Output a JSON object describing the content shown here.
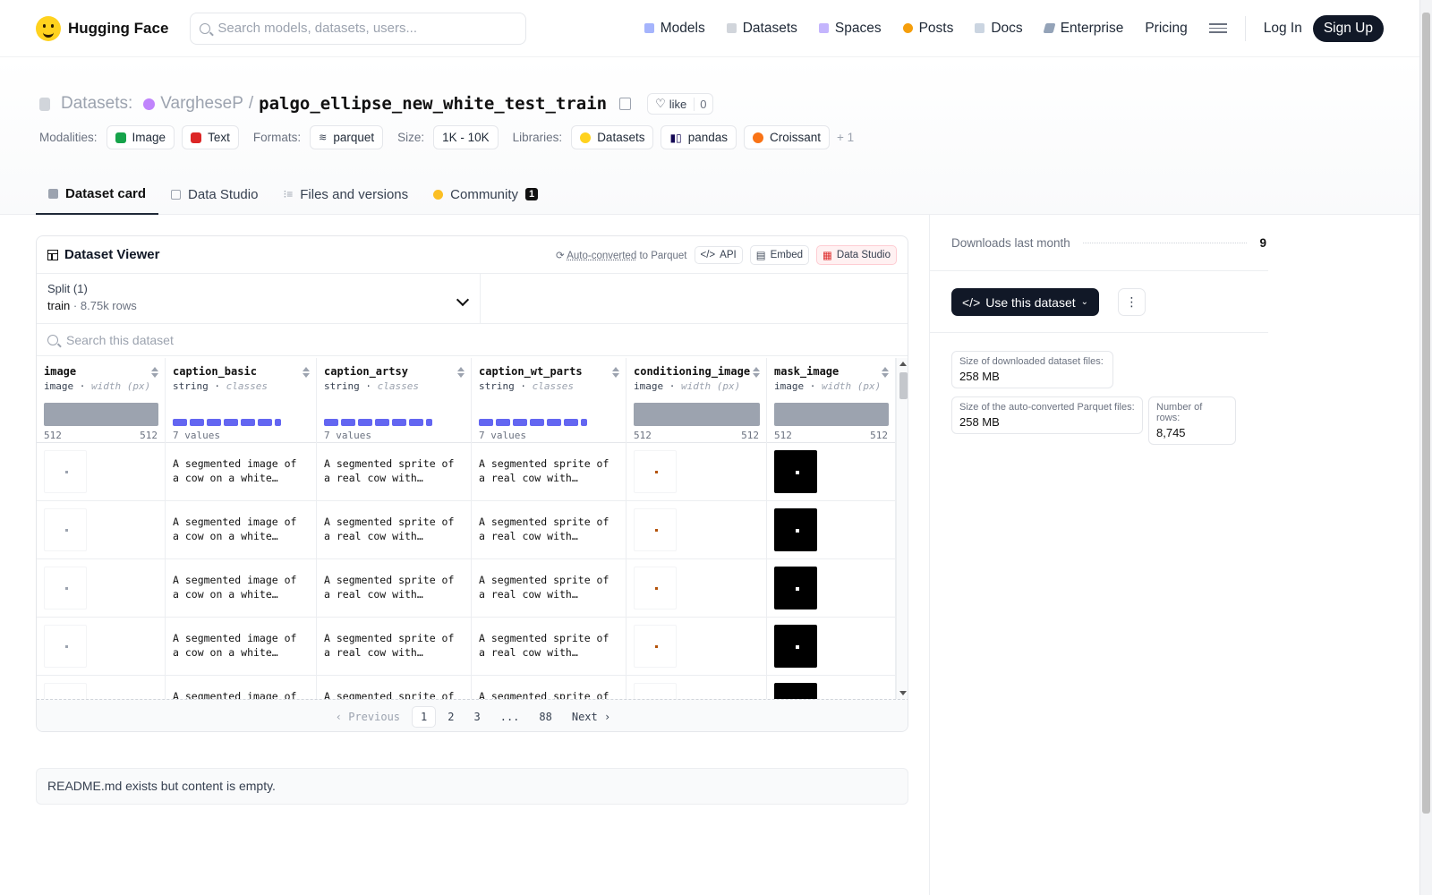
{
  "nav": {
    "brand": "Hugging Face",
    "search_placeholder": "Search models, datasets, users...",
    "links": [
      "Models",
      "Datasets",
      "Spaces",
      "Posts",
      "Docs",
      "Enterprise",
      "Pricing"
    ],
    "login": "Log In",
    "signup": "Sign Up"
  },
  "repo": {
    "section": "Datasets:",
    "owner": "VargheseP",
    "slash": "/",
    "name": "palgo_ellipse_new_white_test_train",
    "like_label": "like",
    "like_count": "0"
  },
  "meta": {
    "modalities_label": "Modalities:",
    "modalities": [
      "Image",
      "Text"
    ],
    "formats_label": "Formats:",
    "format": "parquet",
    "size_label": "Size:",
    "size": "1K - 10K",
    "libraries_label": "Libraries:",
    "libraries": [
      "Datasets",
      "pandas",
      "Croissant"
    ],
    "more": "+ 1"
  },
  "tabs": [
    "Dataset card",
    "Data Studio",
    "Files and versions",
    "Community"
  ],
  "community_count": "1",
  "viewer": {
    "title": "Dataset Viewer",
    "auto_converted": "Auto-converted",
    "to_parquet": "to Parquet",
    "api": "API",
    "embed": "Embed",
    "data_studio": "Data Studio",
    "split_label": "Split (1)",
    "split_name": "train",
    "split_rows": "8.75k rows",
    "search_placeholder": "Search this dataset",
    "columns": [
      {
        "name": "image",
        "type": "image",
        "sub": "width (px)",
        "min": "512",
        "max": "512"
      },
      {
        "name": "caption_basic",
        "type": "string",
        "sub": "classes",
        "count": "7 values"
      },
      {
        "name": "caption_artsy",
        "type": "string",
        "sub": "classes",
        "count": "7 values"
      },
      {
        "name": "caption_wt_parts",
        "type": "string",
        "sub": "classes",
        "count": "7 values"
      },
      {
        "name": "conditioning_image",
        "type": "image",
        "sub": "width (px)",
        "min": "512",
        "max": "512"
      },
      {
        "name": "mask_image",
        "type": "image",
        "sub": "width (px)",
        "min": "512",
        "max": "512"
      }
    ],
    "rows": [
      {
        "basic": "A segmented image of a cow on a white background",
        "artsy": "A segmented sprite of a real cow with photorealistic detail",
        "parts": "A segmented sprite of a real cow with photorealistic parts"
      },
      {
        "basic": "A segmented image of a cow on a white background",
        "artsy": "A segmented sprite of a real cow with photorealistic detail",
        "parts": "A segmented sprite of a real cow with photorealistic parts"
      },
      {
        "basic": "A segmented image of a cow on a white background",
        "artsy": "A segmented sprite of a real cow with photorealistic detail",
        "parts": "A segmented sprite of a real cow with photorealistic parts"
      },
      {
        "basic": "A segmented image of a cow on a white background",
        "artsy": "A segmented sprite of a real cow with photorealistic detail",
        "parts": "A segmented sprite of a real cow with photorealistic parts"
      },
      {
        "basic": "A segmented image of a cow on a white background",
        "artsy": "A segmented sprite of a real cow with photorealistic detail",
        "parts": "A segmented sprite of a real cow with photorealistic parts"
      }
    ],
    "pager": {
      "prev": "Previous",
      "pages": [
        "1",
        "2",
        "3",
        "...",
        "88"
      ],
      "next": "Next"
    }
  },
  "readme": "README.md exists but content is empty.",
  "sidebar": {
    "downloads_label": "Downloads last month",
    "downloads": "9",
    "use_button": "Use this dataset",
    "dl_size_label": "Size of downloaded dataset files:",
    "dl_size": "258 MB",
    "parquet_size_label": "Size of the auto-converted Parquet files:",
    "parquet_size": "258 MB",
    "rows_label": "Number of rows:",
    "rows": "8,745"
  }
}
